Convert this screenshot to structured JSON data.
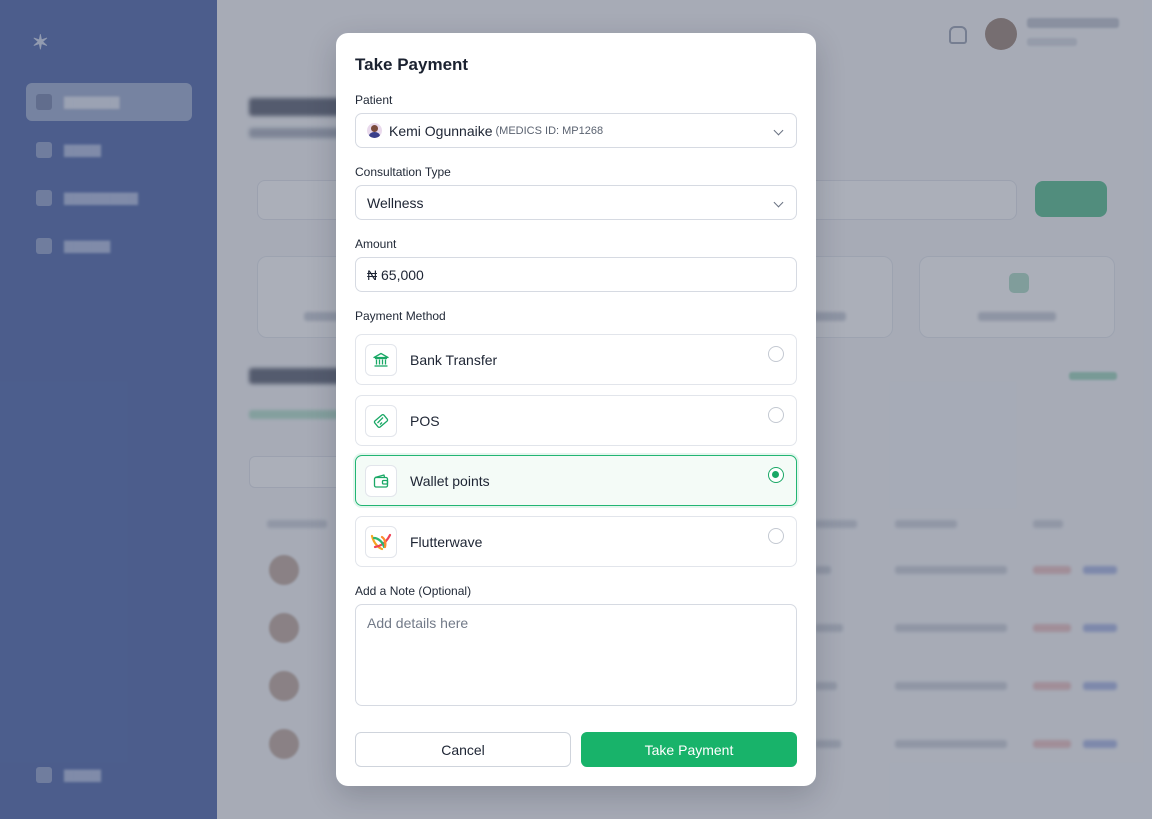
{
  "modal": {
    "title": "Take Payment",
    "patient": {
      "label": "Patient",
      "name": "Kemi Ogunnaike",
      "id_text": "(MEDICS ID: MP1268"
    },
    "consultation": {
      "label": "Consultation Type",
      "value": "Wellness"
    },
    "amount": {
      "label": "Amount",
      "value": "₦ 65,000"
    },
    "payment_method": {
      "label": "Payment Method",
      "options": [
        {
          "label": "Bank Transfer",
          "icon": "bank-icon",
          "selected": false
        },
        {
          "label": "POS",
          "icon": "pos-card-icon",
          "selected": false
        },
        {
          "label": "Wallet points",
          "icon": "wallet-icon",
          "selected": true
        },
        {
          "label": "Flutterwave",
          "icon": "flutterwave-logo-icon",
          "selected": false
        }
      ]
    },
    "note": {
      "label": "Add a Note (Optional)",
      "placeholder": "Add details here"
    },
    "cancel_label": "Cancel",
    "submit_label": "Take Payment"
  },
  "colors": {
    "sidebar": "#2d4b9c",
    "accent_green": "#18b36a",
    "overlay": "rgba(102,110,128,0.55)"
  }
}
